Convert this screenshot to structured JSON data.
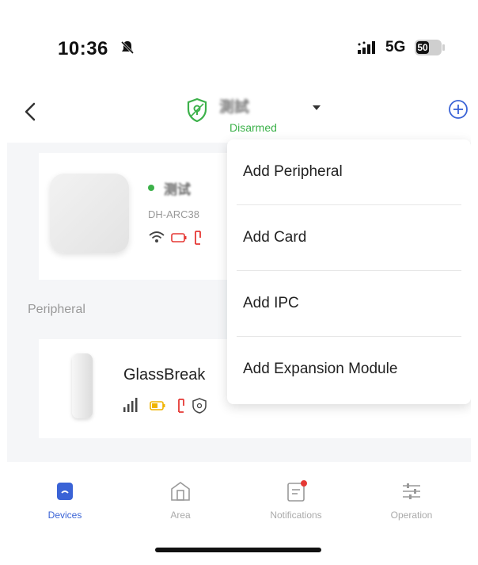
{
  "status_bar": {
    "time": "10:36",
    "network": "5G",
    "battery": "50"
  },
  "header": {
    "home_name": "測試",
    "status": "Disarmed",
    "status_color": "#3cb14a"
  },
  "hub": {
    "name": "测试",
    "model": "DH-ARC38"
  },
  "section": {
    "peripheral_label": "Peripheral"
  },
  "peripheral": {
    "name": "GlassBreak"
  },
  "menu": {
    "items": [
      {
        "label": "Add Peripheral"
      },
      {
        "label": "Add Card"
      },
      {
        "label": "Add IPC"
      },
      {
        "label": "Add Expansion Module"
      }
    ]
  },
  "tabs": [
    {
      "label": "Devices",
      "icon": "devices-icon",
      "active": true
    },
    {
      "label": "Area",
      "icon": "area-icon"
    },
    {
      "label": "Notifications",
      "icon": "notifications-icon",
      "badge": true
    },
    {
      "label": "Operation",
      "icon": "operation-icon"
    }
  ],
  "colors": {
    "accent": "#3a63d6",
    "online": "#3cb14a",
    "alert": "#e53935",
    "warning": "#f0b400"
  }
}
